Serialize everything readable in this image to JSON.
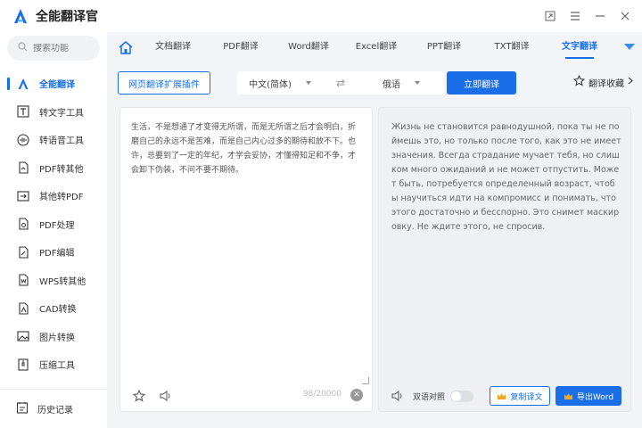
{
  "app": {
    "title": "全能翻译官"
  },
  "colors": {
    "accent": "#1a6fe8",
    "crown": "#f5a623"
  },
  "search": {
    "placeholder": "搜索功能"
  },
  "sidebar": {
    "items": [
      {
        "label": "全能翻译",
        "icon": "translate-icon"
      },
      {
        "label": "转文字工具",
        "icon": "text-tool-icon"
      },
      {
        "label": "转语音工具",
        "icon": "voice-tool-icon"
      },
      {
        "label": "PDF转其他",
        "icon": "pdf-convert-icon"
      },
      {
        "label": "其他转PDF",
        "icon": "to-pdf-icon"
      },
      {
        "label": "PDF处理",
        "icon": "pdf-process-icon"
      },
      {
        "label": "PDF编辑",
        "icon": "pdf-edit-icon"
      },
      {
        "label": "WPS转其他",
        "icon": "wps-icon"
      },
      {
        "label": "CAD转换",
        "icon": "cad-icon"
      },
      {
        "label": "图片转换",
        "icon": "image-icon"
      },
      {
        "label": "压缩工具",
        "icon": "compress-icon"
      }
    ],
    "history": "历史记录"
  },
  "tabs": [
    "文档翻译",
    "PDF翻译",
    "Word翻译",
    "Excel翻译",
    "PPT翻译",
    "TXT翻译",
    "文字翻译"
  ],
  "toolbar": {
    "extension": "网页翻译扩展插件",
    "source_lang": "中文(简体)",
    "target_lang": "俄语",
    "translate": "立即翻译",
    "favorites": "翻译收藏"
  },
  "source": {
    "text": "生活，不是想通了才变得无所谓，而是无所谓之后才会明白，折磨自己的永远不是苦难，而是自己内心过多的期待和放不下。也许，总要到了一定的年纪，才学会妥协，才懂得知足和不争，才会卸下伪装，不问不要不期待。",
    "count": "98/20000"
  },
  "target": {
    "text": "Жизнь не становится равнодушной, пока ты не поймешь это, но только после того, как это не имеет значения. Всегда страдание мучает тебя, но слишком много ожиданий и не может отпустить. Может быть, потребуется определенный возраст, чтобы научиться идти на компромисс и понимать, что этого достаточно и бесспорно. Это снимет маскировку. Не ждите этого, не спросив.",
    "bilingual": "双语对照",
    "copy": "复制译文",
    "export": "导出Word"
  }
}
